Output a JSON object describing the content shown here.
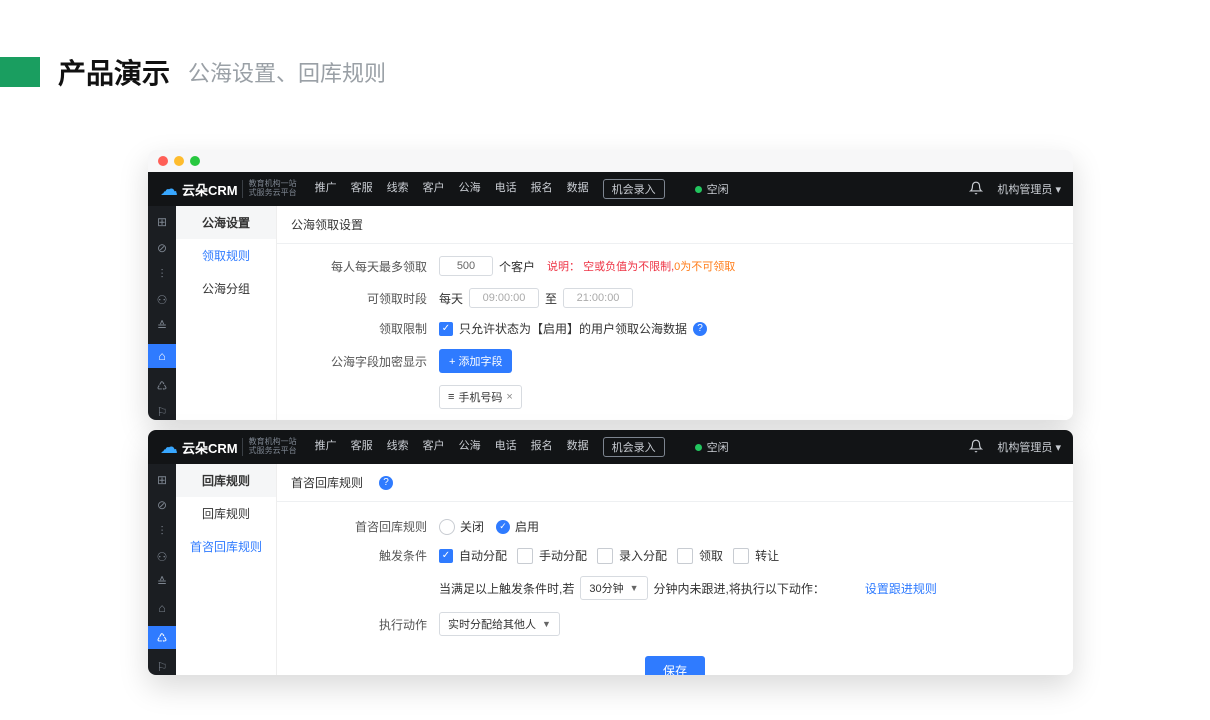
{
  "slide": {
    "title_main": "产品演示",
    "title_sub": "公海设置、回库规则"
  },
  "brand": {
    "name": "云朵CRM",
    "tagline1": "教育机构一站",
    "tagline2": "式服务云平台"
  },
  "topnav": {
    "items": [
      "推广",
      "客服",
      "线索",
      "客户",
      "公海",
      "电话",
      "报名",
      "数据"
    ],
    "pill": "机会录入"
  },
  "status": {
    "text": "空闲"
  },
  "user": {
    "role": "机构管理员"
  },
  "win1": {
    "side_title": "公海设置",
    "side_items": [
      {
        "label": "领取规则",
        "active": true
      },
      {
        "label": "公海分组",
        "active": false
      }
    ],
    "section_title": "公海领取设置",
    "rows": {
      "max_per_day": {
        "label": "每人每天最多领取",
        "value": "500",
        "unit": "个客户",
        "hint_prefix": "说明：",
        "hint_main": "空或负值为不限制,",
        "hint_tail": "0为不可领取"
      },
      "time_window": {
        "label": "可领取时段",
        "prefix": "每天",
        "start": "09:00:00",
        "sep": "至",
        "end": "21:00:00"
      },
      "restrict": {
        "label": "领取限制",
        "checked": true,
        "text": "只允许状态为【启用】的用户领取公海数据"
      },
      "encrypt": {
        "label": "公海字段加密显示",
        "add_btn": "+ 添加字段",
        "tag_icon": "≡",
        "tag_text": "手机号码",
        "tag_close": "×"
      }
    }
  },
  "win2": {
    "side_title": "回库规则",
    "side_items": [
      {
        "label": "回库规则",
        "active": false
      },
      {
        "label": "首咨回库规则",
        "active": true
      }
    ],
    "section_title": "首咨回库规则",
    "rows": {
      "enable": {
        "label": "首咨回库规则",
        "off": "关闭",
        "on": "启用"
      },
      "trigger": {
        "label": "触发条件",
        "opts": [
          {
            "label": "自动分配",
            "checked": true
          },
          {
            "label": "手动分配",
            "checked": false
          },
          {
            "label": "录入分配",
            "checked": false
          },
          {
            "label": "领取",
            "checked": false
          },
          {
            "label": "转让",
            "checked": false
          }
        ]
      },
      "cond": {
        "pre": "当满足以上触发条件时,若",
        "sel": "30分钟",
        "mid": "分钟内未跟进,将执行以下动作：",
        "link": "设置跟进规则"
      },
      "action": {
        "label": "执行动作",
        "sel": "实时分配给其他人"
      },
      "save": "保存"
    }
  },
  "rail_icons": [
    "⊞",
    "⊘",
    "⫶",
    "⚇",
    "≙",
    "⌂",
    "♺",
    "⚐"
  ]
}
